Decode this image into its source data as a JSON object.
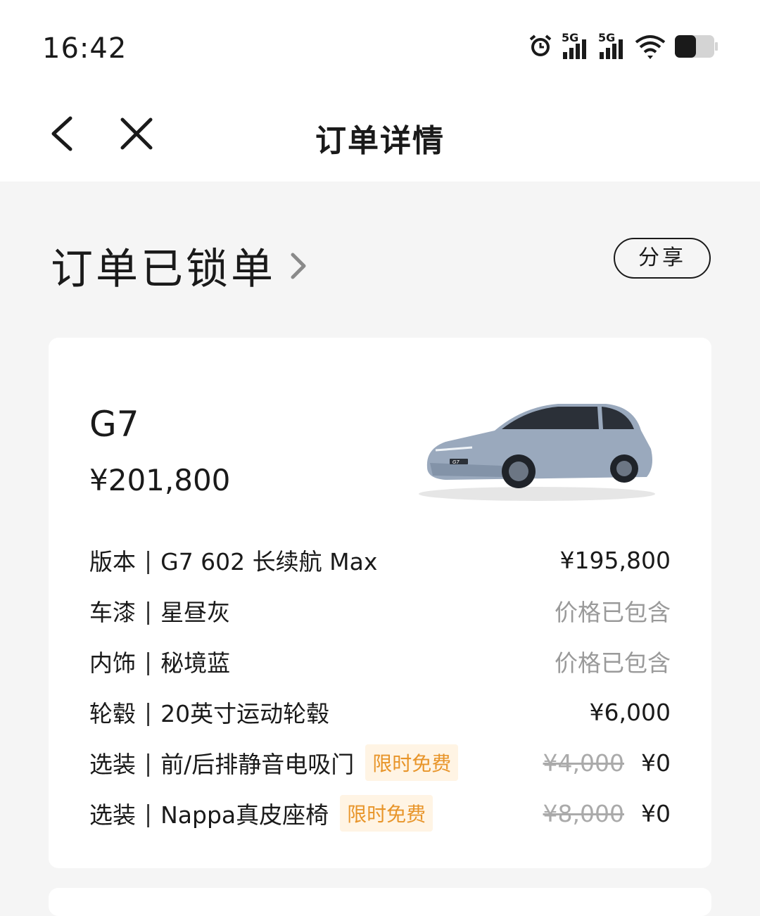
{
  "status_bar": {
    "time": "16:42",
    "signal1_label": "5G",
    "signal2_label": "5G",
    "icons": [
      "alarm-icon",
      "signal-5g-icon",
      "signal-5g-icon",
      "wifi-icon",
      "battery-icon"
    ]
  },
  "nav": {
    "title": "订单详情",
    "back_icon": "chevron-left-icon",
    "close_icon": "close-icon"
  },
  "order": {
    "status": "订单已锁单",
    "share_label": "分享"
  },
  "car": {
    "model": "G7",
    "price": "¥201,800",
    "image_badge": "G7"
  },
  "items": [
    {
      "label": "版本",
      "sep": "|",
      "value": "G7 602 长续航 Max",
      "price": "¥195,800"
    },
    {
      "label": "车漆",
      "sep": "|",
      "value": "星昼灰",
      "price": "价格已包含"
    },
    {
      "label": "内饰",
      "sep": "|",
      "value": "秘境蓝",
      "price": "价格已包含"
    },
    {
      "label": "轮毂",
      "sep": "|",
      "value": "20英寸运动轮毂",
      "price": "¥6,000"
    },
    {
      "label": "选装",
      "sep": "|",
      "value": "前/后排静音电吸门",
      "badge": "限时免费",
      "original_price": "¥4,000",
      "price": "¥0"
    },
    {
      "label": "选装",
      "sep": "|",
      "value": "Nappa真皮座椅",
      "badge": "限时免费",
      "original_price": "¥8,000",
      "price": "¥0"
    }
  ],
  "colors": {
    "page_bg": "#f5f5f5",
    "card_bg": "#ffffff",
    "badge_bg": "#fff4e4",
    "badge_text": "#e8952a",
    "muted_text": "#9a9a9a"
  }
}
